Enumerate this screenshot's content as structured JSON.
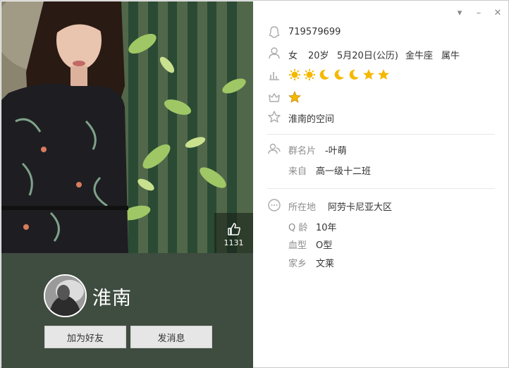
{
  "window": {
    "controls": {
      "menu": "▾",
      "minimize": "–",
      "close": "✕"
    }
  },
  "profile": {
    "nickname": "淮南",
    "likes": "1131",
    "buttons": {
      "add_friend": "加为好友",
      "send_message": "发消息"
    }
  },
  "info": {
    "qq_number": "719579699",
    "gender": "女",
    "age": "20岁",
    "birthday": "5月20日(公历)",
    "zodiac": "金牛座",
    "chinese_zodiac": "属牛",
    "level_icons": [
      "sun",
      "sun",
      "moon",
      "moon",
      "moon",
      "star",
      "star"
    ],
    "vip_icon": "crown-star",
    "space": "淮南的空间"
  },
  "group": {
    "card_label": "群名片",
    "card_value": "-叶萌",
    "from_label": "来自",
    "from_value": "高一级十二班"
  },
  "details": {
    "location_label": "所在地",
    "location_value": "阿劳卡尼亚大区",
    "qage_label": "Q 龄",
    "qage_value": "10年",
    "blood_label": "血型",
    "blood_value": "O型",
    "hometown_label": "家乡",
    "hometown_value": "文莱"
  },
  "colors": {
    "panel": "#3f4c40",
    "icon_gold": "#f5b800",
    "label_gray": "#8c8c8c"
  }
}
